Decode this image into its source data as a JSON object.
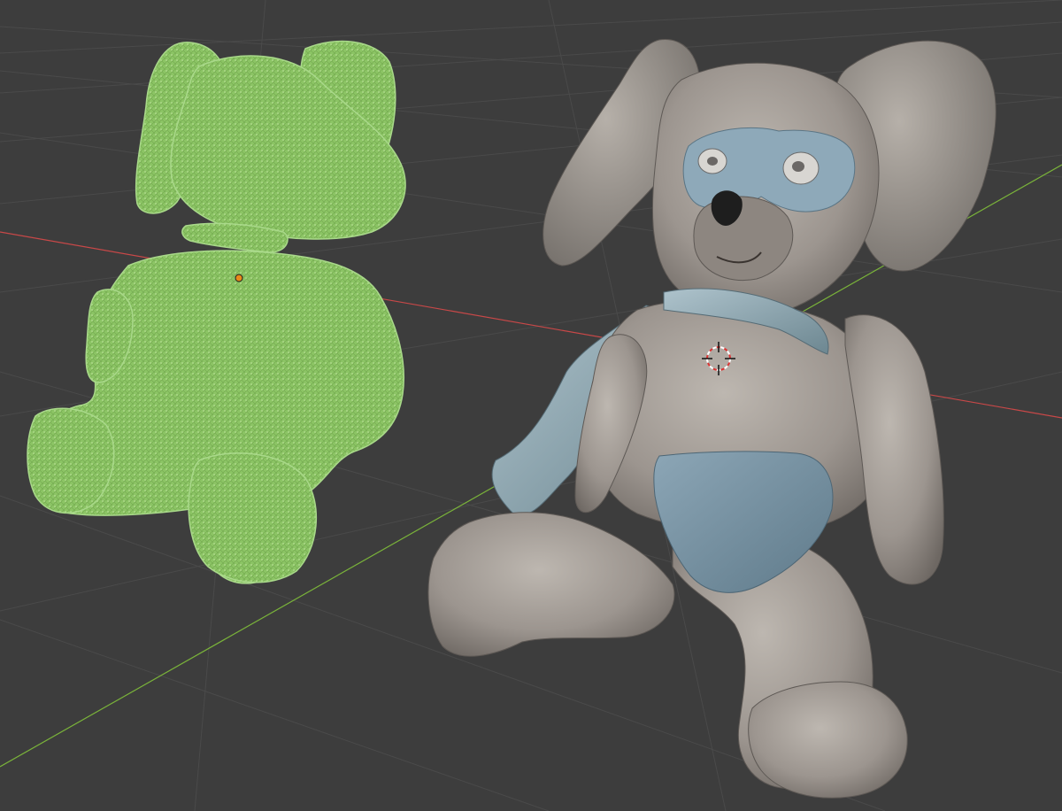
{
  "viewport": {
    "background": "#3d3d3d",
    "grid_color": "#4a4a4a",
    "x_axis_color": "#c84848",
    "y_axis_color": "#7ab33a"
  },
  "objects": [
    {
      "name": "bunny-wireframe-selected",
      "display": "wireframe",
      "selected": true,
      "color": "#8dc665"
    },
    {
      "name": "bunny-plush-solid",
      "display": "solid",
      "selected": false,
      "body_color": "#9a948e",
      "accent_color": "#7b97aa"
    }
  ],
  "cursor": {
    "name": "3d-cursor-icon"
  },
  "origin": {
    "name": "object-origin-icon",
    "color": "#e88a1a"
  }
}
